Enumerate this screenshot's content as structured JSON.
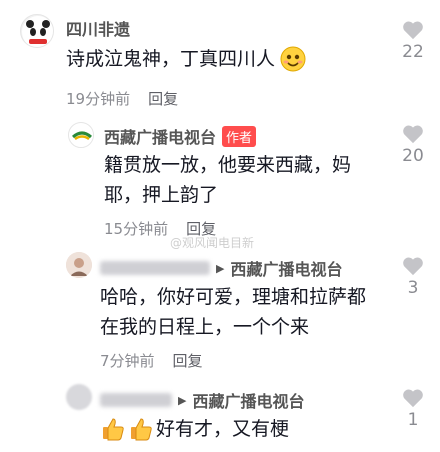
{
  "comments": [
    {
      "name": "四川非遗",
      "text": "诗成泣鬼神，丁真四川人",
      "time": "19分钟前",
      "reply": "回复",
      "likes": "22"
    },
    {
      "name": "西藏广播电视台",
      "badge": "作者",
      "text_line1": "籍贯放一放，他要来西藏，妈",
      "text_line2": "耶，押上韵了",
      "time": "15分钟前",
      "reply": "回复",
      "likes": "20"
    },
    {
      "reply_to": "西藏广播电视台",
      "text_line1": "哈哈，你好可爱，理塘和拉萨都",
      "text_line2": "在我的日程上，一个个来",
      "time": "7分钟前",
      "reply": "回复",
      "likes": "3"
    },
    {
      "reply_to": "西藏广播电视台",
      "text": "好有才，又有梗",
      "likes": "1"
    }
  ],
  "watermark": "@观风闻电目新",
  "colors": {
    "heart": "#c4c4c8",
    "badge": "#ff4d4d",
    "meta": "#8a8b91"
  }
}
